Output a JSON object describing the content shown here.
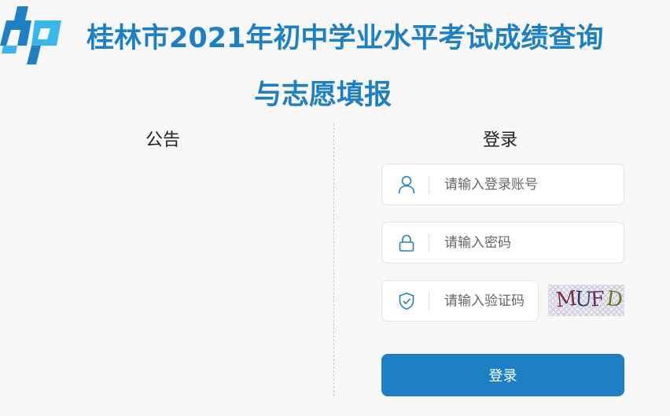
{
  "header": {
    "title_line1": "桂林市2021年初中学业水平考试成绩查询",
    "title_line2": "与志愿填报"
  },
  "announcement": {
    "title": "公告"
  },
  "login": {
    "title": "登录",
    "username_placeholder": "请输入登录账号",
    "password_placeholder": "请输入密码",
    "captcha_placeholder": "请输入验证码",
    "captcha_text": "MUFD",
    "submit_label": "登录"
  },
  "icons": {
    "logo": "logo-icon",
    "username": "user-icon",
    "password": "lock-icon",
    "captcha": "shield-check-icon"
  },
  "colors": {
    "brand": "#1e80c4",
    "logo_light": "#39b6ea",
    "background": "#f7f7f7"
  }
}
